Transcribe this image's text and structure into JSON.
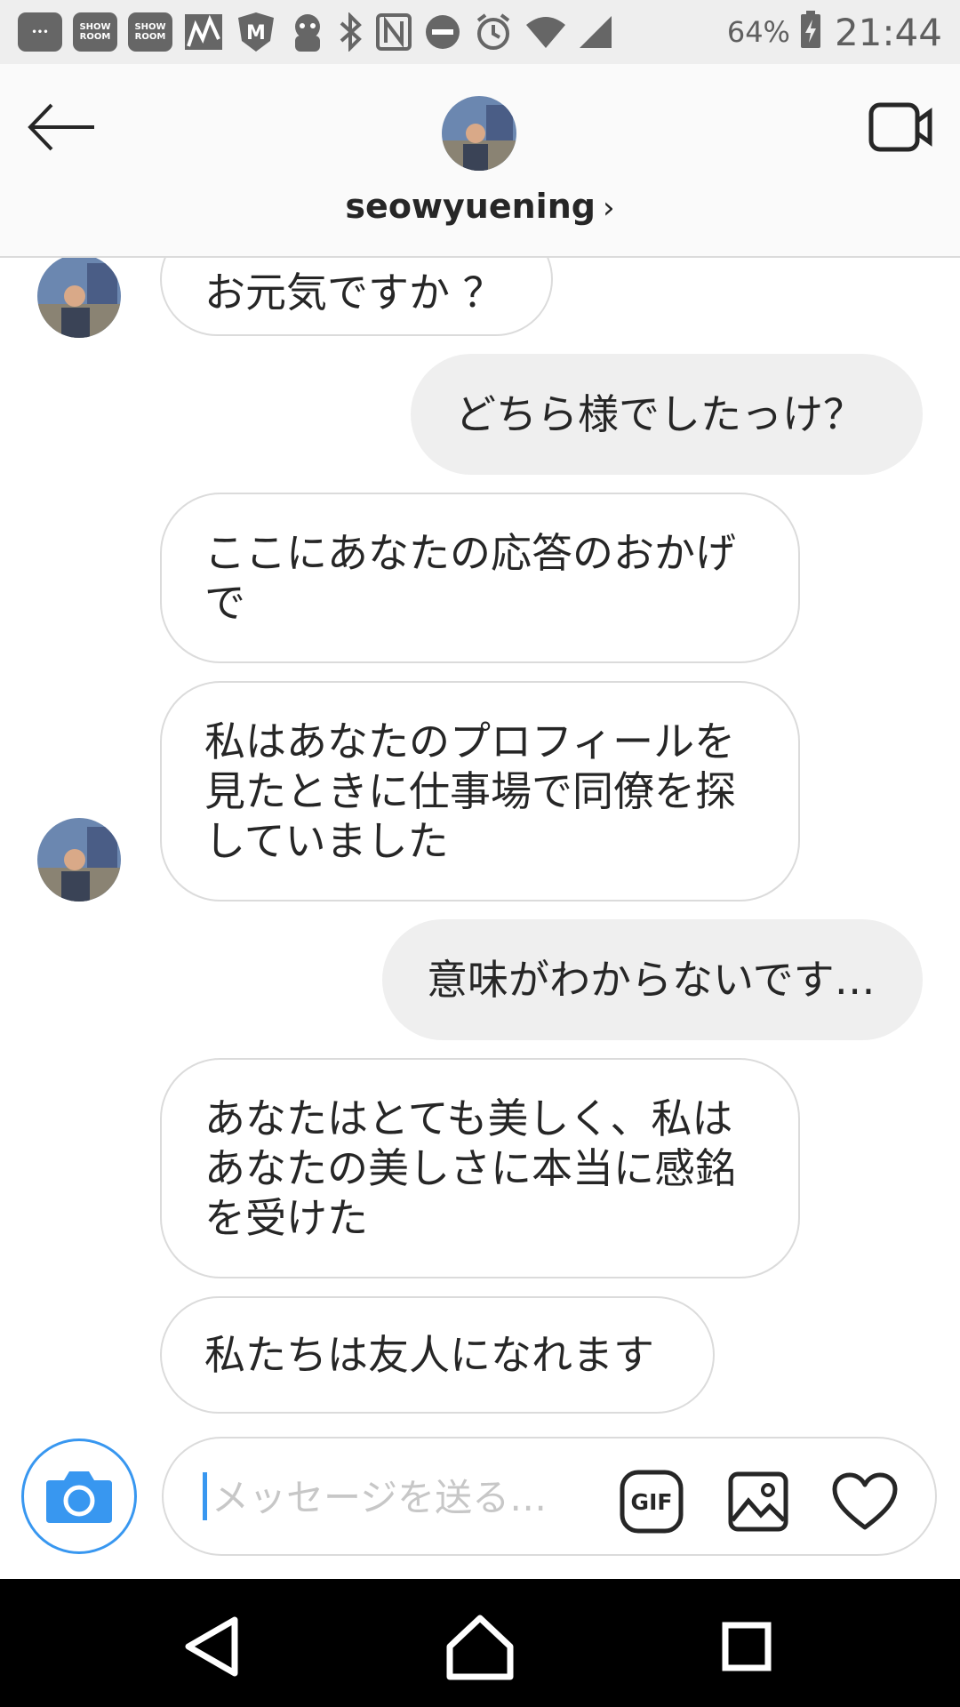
{
  "status_bar": {
    "box_icons": [
      "SHOW ROOM",
      "SHOW ROOM"
    ],
    "battery": "64%",
    "time": "21:44"
  },
  "header": {
    "username": "seowyuening",
    "chevron": "›"
  },
  "messages": [
    {
      "side": "in",
      "text": "お元気ですか ？"
    },
    {
      "side": "out",
      "text": "どちら様でしたっけ？"
    },
    {
      "side": "in",
      "text": "ここにあなたの応答のおかげ\nで"
    },
    {
      "side": "in",
      "text": "私はあなたのプロフィールを\n見たときに仕事場で同僚を探\nしていました"
    },
    {
      "side": "out",
      "text": "意味がわからないです…"
    },
    {
      "side": "in",
      "text": "あなたはとても美しく、私は\nあなたの美しさに本当に感銘\nを受けた"
    },
    {
      "side": "in",
      "text": "私たちは友人になれます"
    }
  ],
  "composer": {
    "placeholder": "メッセージを送る…",
    "gif_label": "GIF"
  },
  "colors": {
    "accent": "#3897f0",
    "outgoing_bubble": "#efefef",
    "border": "#dbdbdb"
  }
}
